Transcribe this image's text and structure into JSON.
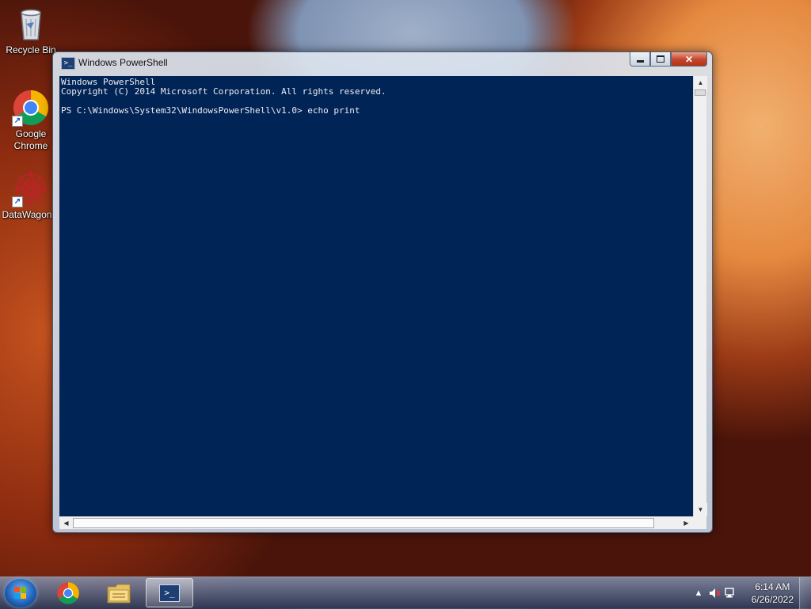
{
  "desktop": {
    "icons": [
      {
        "label": "Recycle Bin",
        "icon": "recycle-bin-icon"
      },
      {
        "label": "Google Chrome",
        "icon": "chrome-icon"
      },
      {
        "label": "DataWagon...",
        "icon": "datawagon-icon"
      }
    ]
  },
  "window": {
    "title": "Windows PowerShell",
    "buttons": {
      "minimize": "minimize",
      "maximize": "maximize",
      "close": "close"
    },
    "console": {
      "lines": [
        "Windows PowerShell",
        "Copyright (C) 2014 Microsoft Corporation. All rights reserved.",
        "",
        "PS C:\\Windows\\System32\\WindowsPowerShell\\v1.0> echo print"
      ]
    }
  },
  "taskbar": {
    "items": [
      {
        "name": "start",
        "icon": "windows-start-icon"
      },
      {
        "name": "chrome",
        "icon": "chrome-icon"
      },
      {
        "name": "explorer",
        "icon": "folder-icon"
      },
      {
        "name": "powershell",
        "icon": "powershell-icon",
        "active": true
      }
    ],
    "clock": {
      "time": "6:14 AM",
      "date": "6/26/2022"
    }
  }
}
